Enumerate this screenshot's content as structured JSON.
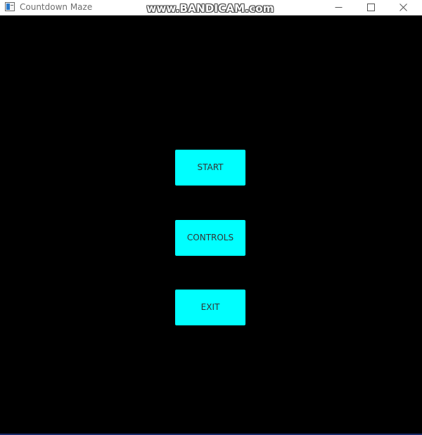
{
  "window": {
    "title": "Countdown Maze",
    "icon": "app-window-icon",
    "controls": {
      "minimize_icon": "minimize-icon",
      "maximize_icon": "maximize-icon",
      "close_icon": "close-icon"
    }
  },
  "watermark": {
    "text": "www.BANDICAM.com"
  },
  "menu": {
    "buttons": [
      {
        "label": "START"
      },
      {
        "label": "CONTROLS"
      },
      {
        "label": "EXIT"
      }
    ]
  },
  "colors": {
    "background": "#000000",
    "button_fill": "#00ffff",
    "button_text": "#333333",
    "titlebar": "#ffffff"
  }
}
